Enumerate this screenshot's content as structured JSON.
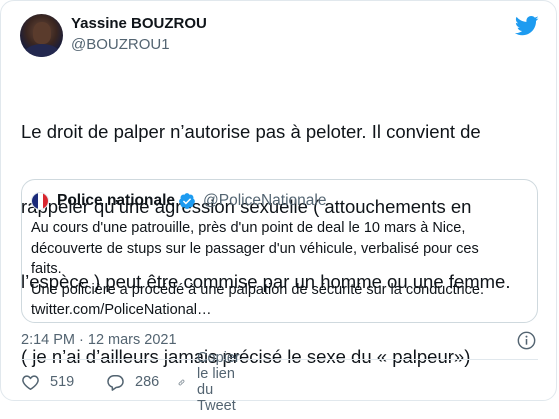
{
  "author": {
    "name": "Yassine BOUZROU",
    "handle": "@BOUZROU1"
  },
  "tweet": {
    "lines": [
      "Le droit de palper n’autorise pas à peloter. Il convient de",
      "rappeler qu’une agression sexuelle ( attouchements en",
      "l’espèce ) peut être commise par un homme ou une femme.",
      "( je n’ai d’ailleurs jamais précisé le sexe du « palpeur»)"
    ]
  },
  "quoted": {
    "name": "Police nationale",
    "handle": "@PoliceNationale",
    "lines": [
      "Au cours d'une patrouille, près d'un point de deal le 10 mars à Nice,",
      "découverte de stups sur le passager d'un véhicule, verbalisé pour ces",
      "faits.",
      "Une policière a procédé à une palpation de sécurité sur la conductrice.",
      "twitter.com/PoliceNational…"
    ]
  },
  "meta": {
    "timestamp": "2:14 PM · 12 mars 2021"
  },
  "actions": {
    "likes": "519",
    "retweets": "286",
    "copy_link": "Copier le lien du Tweet"
  },
  "colors": {
    "twitter_blue": "#1d9bf0",
    "like_red": "#f91880",
    "retweet_green": "#00ba7c",
    "secondary_text": "#536471"
  },
  "icons": {
    "logo": "twitter-bird-icon",
    "verified": "verified-badge-icon",
    "info": "info-icon",
    "like": "heart-icon",
    "retweet": "retweet-icon",
    "share": "link-icon"
  }
}
